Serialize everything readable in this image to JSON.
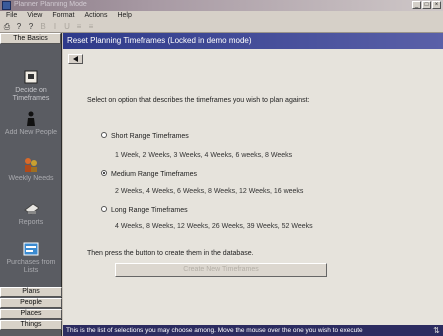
{
  "window": {
    "title": "Planner Planning Mode"
  },
  "menu": [
    "File",
    "View",
    "Format",
    "Actions",
    "Help"
  ],
  "toolbar": {
    "icons": [
      "printer-icon",
      "help-icon",
      "help-icon",
      "bold-icon",
      "italic-icon",
      "underline-icon",
      "align-icon"
    ]
  },
  "sidebar": {
    "header": "The Basics",
    "items": [
      {
        "label": "Decide on Timeframes",
        "icon": "calendar-icon"
      },
      {
        "label": "Add New People",
        "icon": "person-icon"
      },
      {
        "label": "Weekly Needs",
        "icon": "people-icon"
      },
      {
        "label": "Reports",
        "icon": "printer-icon"
      },
      {
        "label": "Purchases from Lists",
        "icon": "list-icon"
      }
    ],
    "tabs": [
      "Plans",
      "People",
      "Places",
      "Things"
    ]
  },
  "panel": {
    "title": "Reset Planning Timeframes (Locked in demo mode)",
    "instruction": "Select on option that describes the timeframes you wish to plan against:",
    "options": [
      {
        "label": "Short Range Timeframes",
        "desc": "1 Week, 2 Weeks, 3 Weeks, 4 Weeks, 6 weeks, 8 Weeks",
        "checked": false
      },
      {
        "label": "Medium Range Timeframes",
        "desc": "2 Weeks, 4 Weeks, 6 Weeks, 8 Weeks, 12 Weeks, 16 weeks",
        "checked": true
      },
      {
        "label": "Long Range Timeframes",
        "desc": "4 Weeks, 8 Weeks, 12 Weeks, 26 Weeks, 39 Weeks, 52 Weeks",
        "checked": false
      }
    ],
    "then_text": "Then press the button to create them in the database.",
    "create_button": "Create New Timeframes"
  },
  "status": {
    "text": "This is the list of selections you may choose among. Move the mouse over the one you wish to execute"
  },
  "colors": {
    "panel_title": "#2e3a8a",
    "sidebar": "#5a5c62",
    "status_bg": "#2c2c60"
  }
}
